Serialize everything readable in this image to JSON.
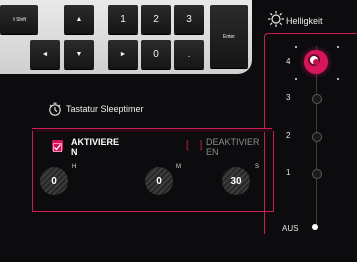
{
  "keyboard": {
    "shift": "⇧Shift",
    "up": "▲",
    "down": "▼",
    "left": "◄",
    "right": "►",
    "k1": "1",
    "k2": "2",
    "k3": "3",
    "k0": "0",
    "dot": ".",
    "enter": "Enter"
  },
  "brightness": {
    "title": "Helligkeit",
    "levels": [
      "4",
      "3",
      "2",
      "1",
      "AUS"
    ],
    "selected": "4"
  },
  "sleep_timer": {
    "title": "Tastatur Sleeptimer",
    "enable_label": "AKTIVIERE\nN",
    "disable_label": "DEAKTIVIER\nEN",
    "enable_checked": true,
    "hours": "0",
    "minutes": "0",
    "seconds": "30",
    "hours_unit": "H",
    "minutes_unit": "M",
    "seconds_unit": "S"
  },
  "colors": {
    "accent": "#cc1d52",
    "background": "#0c0c0e"
  }
}
